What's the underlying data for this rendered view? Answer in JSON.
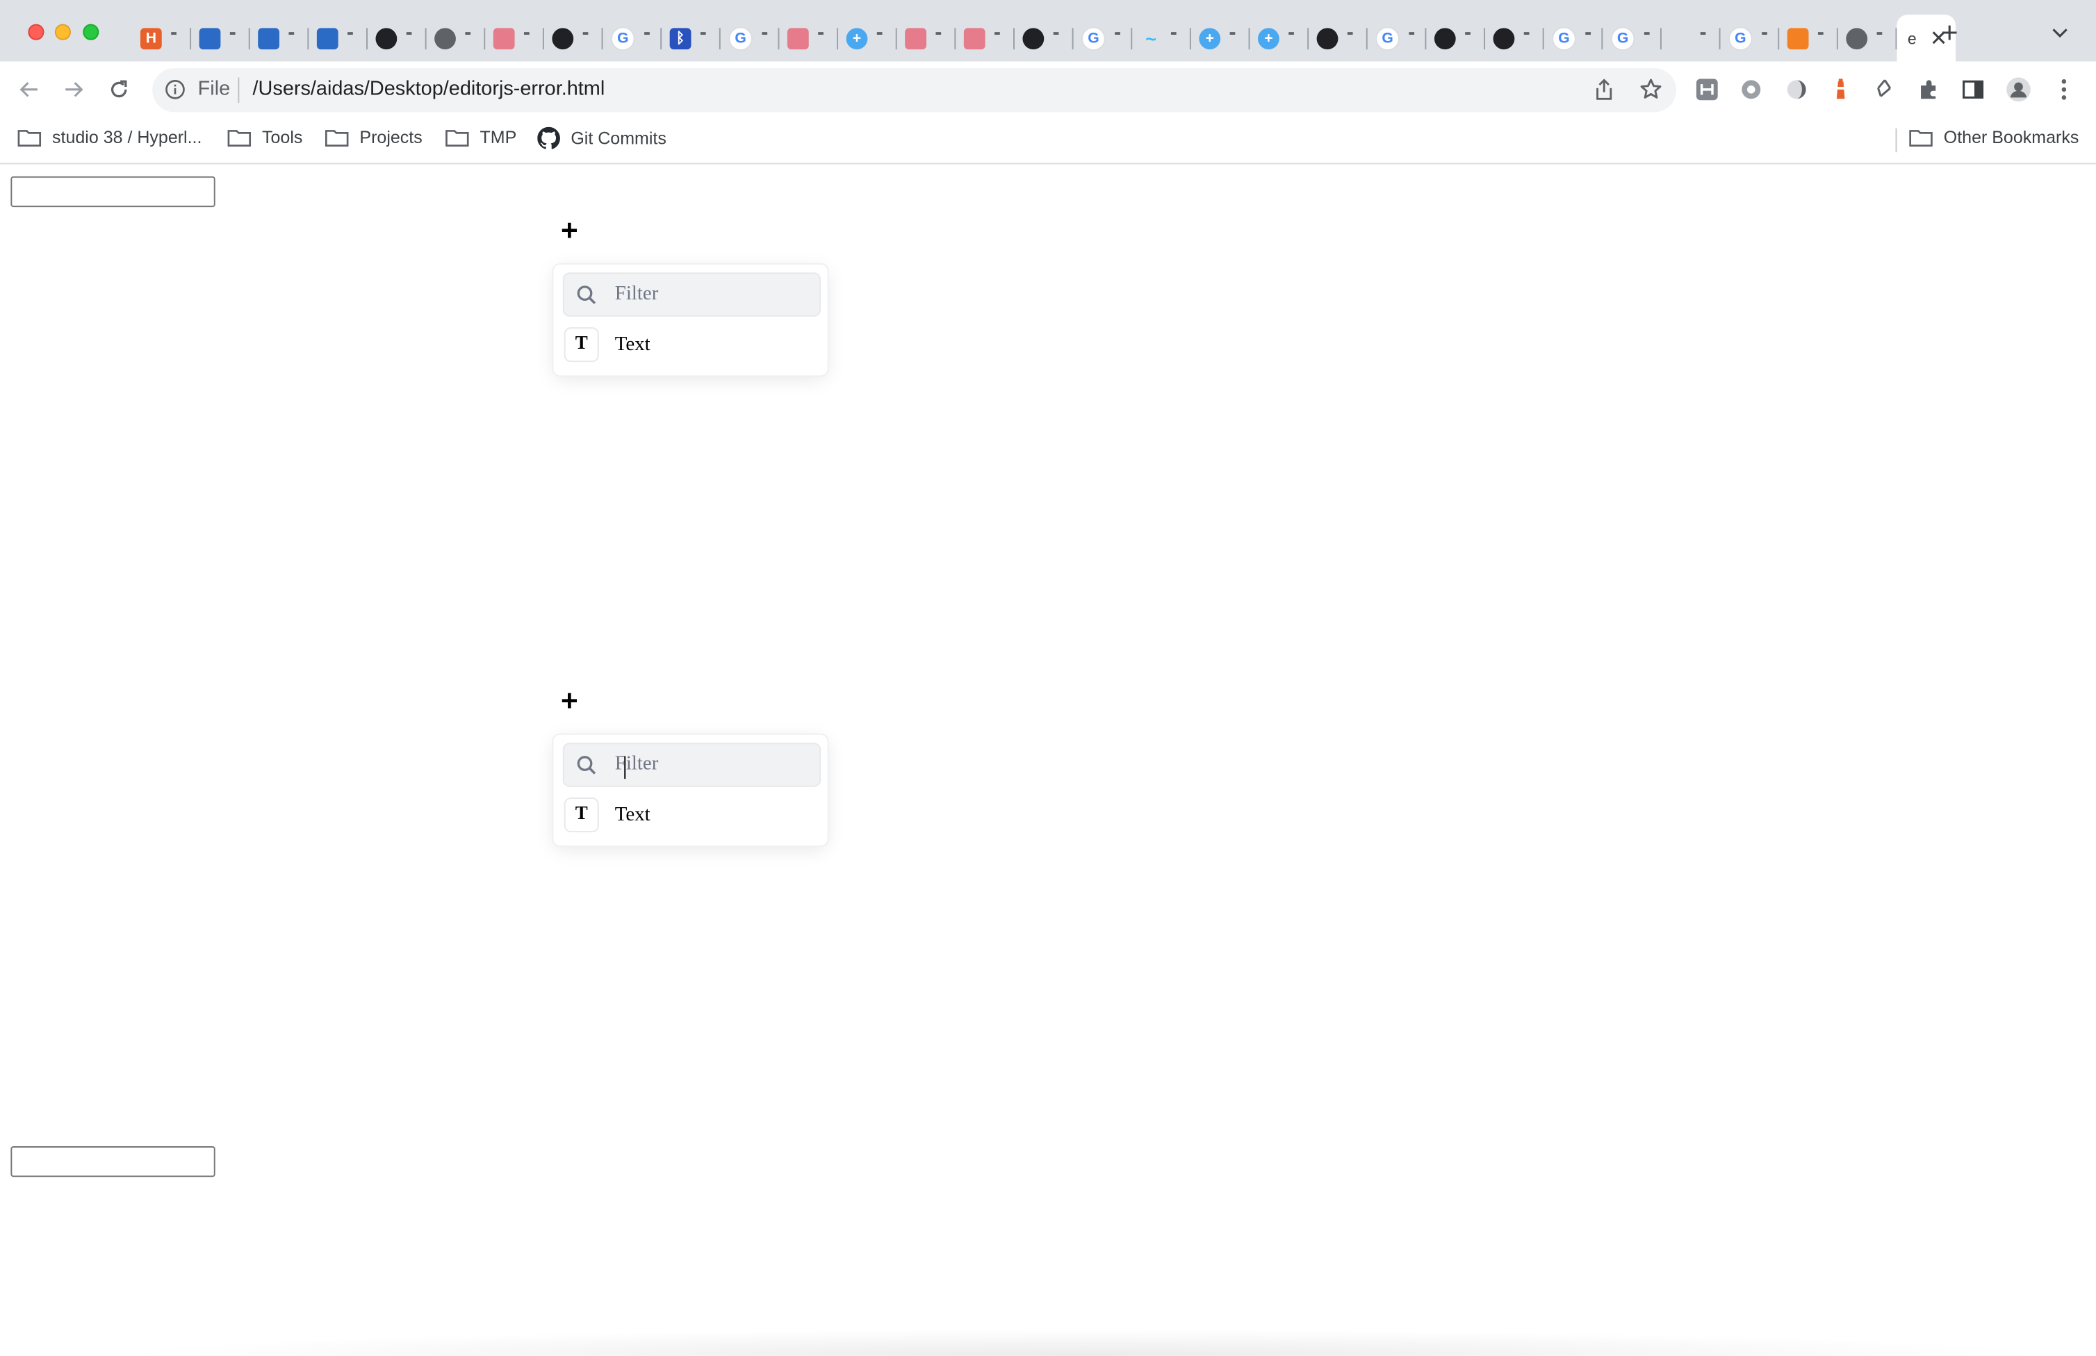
{
  "window": {
    "controls": [
      "close",
      "minimize",
      "zoom"
    ]
  },
  "tabs": {
    "favicons": [
      {
        "icon": "hyperlane-icon",
        "color": "#e8612c"
      },
      {
        "icon": "trello-icon",
        "color": "#2b6bc6"
      },
      {
        "icon": "trello-icon",
        "color": "#2b6bc6"
      },
      {
        "icon": "trello-icon",
        "color": "#2b6bc6"
      },
      {
        "icon": "circle-icon",
        "color": "#202124"
      },
      {
        "icon": "globe-icon",
        "color": "#5f6368"
      },
      {
        "icon": "app-icon",
        "color": "#e57b8b"
      },
      {
        "icon": "circle-icon",
        "color": "#202124"
      },
      {
        "icon": "google-icon",
        "color": "#4285f4"
      },
      {
        "icon": "bluetooth-icon",
        "color": "#2a52be"
      },
      {
        "icon": "google-icon",
        "color": "#4285f4"
      },
      {
        "icon": "app-icon",
        "color": "#e57b8b"
      },
      {
        "icon": "plus-circle-icon",
        "color": "#4aa8f0"
      },
      {
        "icon": "app-icon",
        "color": "#e57b8b"
      },
      {
        "icon": "app-icon",
        "color": "#e57b8b"
      },
      {
        "icon": "circle-icon",
        "color": "#202124"
      },
      {
        "icon": "google-icon",
        "color": "#4285f4"
      },
      {
        "icon": "tailwind-icon",
        "color": "#38bdf8"
      },
      {
        "icon": "plus-circle-icon",
        "color": "#4aa8f0"
      },
      {
        "icon": "plus-circle-icon",
        "color": "#4aa8f0"
      },
      {
        "icon": "github-icon",
        "color": "#202124"
      },
      {
        "icon": "google-icon",
        "color": "#4285f4"
      },
      {
        "icon": "github-icon",
        "color": "#202124"
      },
      {
        "icon": "github-icon",
        "color": "#202124"
      },
      {
        "icon": "google-icon",
        "color": "#4285f4"
      },
      {
        "icon": "google-icon",
        "color": "#4285f4"
      },
      {
        "icon": "moon-icon",
        "color": "#3b82c4"
      },
      {
        "icon": "google-icon",
        "color": "#4285f4"
      },
      {
        "icon": "stackoverflow-icon",
        "color": "#f48024"
      },
      {
        "icon": "chrome-icon",
        "color": "#5f6368"
      }
    ],
    "active_label": "e",
    "new_tab_label": "+"
  },
  "toolbar": {
    "scheme_label": "File",
    "url": "/Users/aidas/Desktop/editorjs-error.html"
  },
  "bookmarks": {
    "items": [
      {
        "label": "studio 38 / Hyperl...",
        "icon": "folder-icon"
      },
      {
        "label": "Tools",
        "icon": "folder-icon"
      },
      {
        "label": "Projects",
        "icon": "folder-icon"
      },
      {
        "label": "TMP",
        "icon": "folder-icon"
      },
      {
        "label": "Git Commits",
        "icon": "github-icon"
      }
    ],
    "other": "Other Bookmarks"
  },
  "editors": [
    {
      "plus": "+",
      "filter_placeholder": "Filter",
      "tool_icon": "T",
      "tool_label": "Text"
    },
    {
      "plus": "+",
      "filter_placeholder": "Filter",
      "tool_icon": "T",
      "tool_label": "Text"
    }
  ],
  "colors": {
    "tabstrip": "#dee1e6",
    "omnibox": "#f1f3f4",
    "search_bg": "#f1f2f4"
  }
}
